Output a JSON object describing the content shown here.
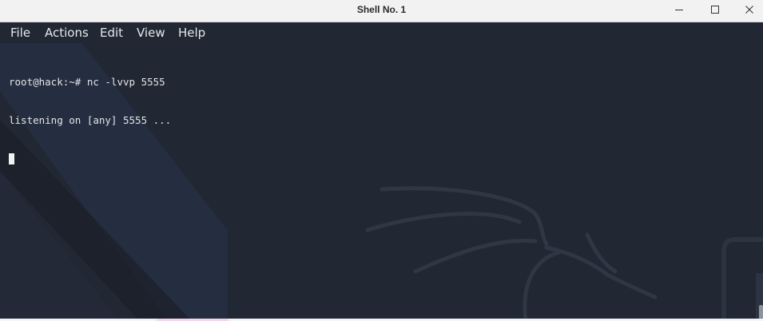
{
  "window": {
    "title": "Shell No. 1",
    "controls": {
      "minimize_icon": "minimize-icon",
      "maximize_icon": "maximize-icon",
      "close_icon": "close-icon"
    }
  },
  "menu": {
    "items": [
      {
        "label": "File"
      },
      {
        "label": "Actions"
      },
      {
        "label": "Edit"
      },
      {
        "label": "View"
      },
      {
        "label": "Help"
      }
    ]
  },
  "terminal": {
    "lines": [
      "root@hack:~# nc -lvvp 5555",
      "listening on [any] 5555 ..."
    ],
    "cursor_visible": true
  },
  "colors": {
    "titlebar_bg": "#f2f2f2",
    "terminal_bg": "#212733",
    "terminal_fg": "#e3e5e8",
    "menu_fg": "#e6e8ec"
  }
}
